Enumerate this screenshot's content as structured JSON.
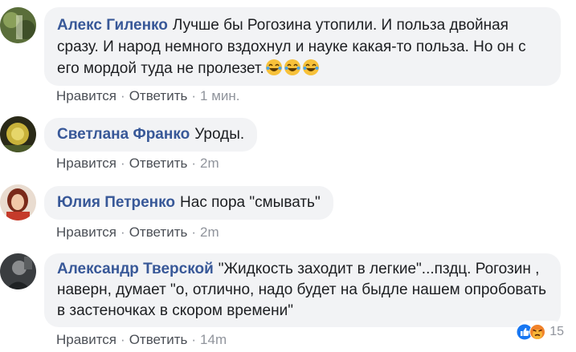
{
  "comments": [
    {
      "author": "Алекс Гиленко",
      "text": "Лучше бы Рогозина утопили. И польза двойная сразу. И народ немного вздохнул и науке какая-то польза. Но он с его мордой туда не пролезет.",
      "emoji": [
        "laughing-emoji",
        "laughing-emoji",
        "laughing-emoji"
      ],
      "like": "Нравится",
      "reply": "Ответить",
      "time": "1 мин."
    },
    {
      "author": "Светлана Франко",
      "text": "Уроды.",
      "like": "Нравится",
      "reply": "Ответить",
      "time": "2m"
    },
    {
      "author": "Юлия Петренко",
      "text": "Нас пора \"смывать\"",
      "like": "Нравится",
      "reply": "Ответить",
      "time": "2m"
    },
    {
      "author": "Александр Тверской",
      "text": "\"Жидкость заходит в легкие\"...пздц. Рогозин , наверн, думает \"о, отлично, надо будет на быдле нашем опробовать в застеночках в скором времени\"",
      "like": "Нравится",
      "reply": "Ответить",
      "time": "14m",
      "reactions": {
        "icons": [
          "like-icon",
          "angry-icon"
        ],
        "count": "15"
      }
    }
  ],
  "separator": "·",
  "colors": {
    "author": "#385898",
    "bubble": "#f2f3f5",
    "like_blue": "#1877f2",
    "angry_orange": "#f0822a"
  }
}
